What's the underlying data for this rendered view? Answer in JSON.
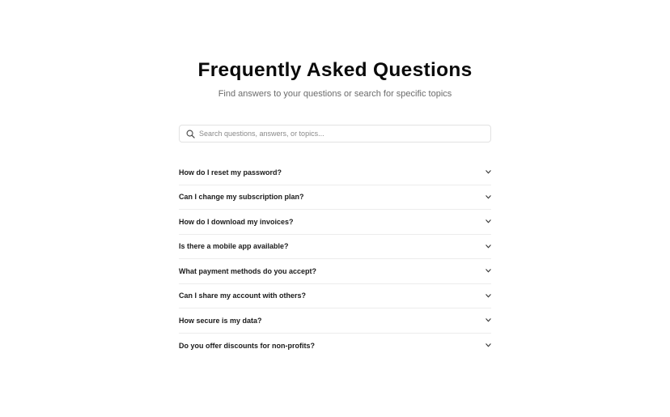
{
  "header": {
    "title": "Frequently Asked Questions",
    "subtitle": "Find answers to your questions or search for specific topics"
  },
  "search": {
    "icon": "search-icon",
    "placeholder": "Search questions, answers, or topics...",
    "value": ""
  },
  "faq": {
    "items": [
      {
        "question": "How do I reset my password?"
      },
      {
        "question": "Can I change my subscription plan?"
      },
      {
        "question": "How do I download my invoices?"
      },
      {
        "question": "Is there a mobile app available?"
      },
      {
        "question": "What payment methods do you accept?"
      },
      {
        "question": "Can I share my account with others?"
      },
      {
        "question": "How secure is my data?"
      },
      {
        "question": "Do you offer discounts for non-profits?"
      }
    ],
    "expand_icon": "chevron-down-icon"
  },
  "colors": {
    "background": "#ffffff",
    "title": "#0a0a0a",
    "subtitle": "#6b6b6b",
    "divider": "#ececec",
    "border": "#e2e2e2"
  }
}
